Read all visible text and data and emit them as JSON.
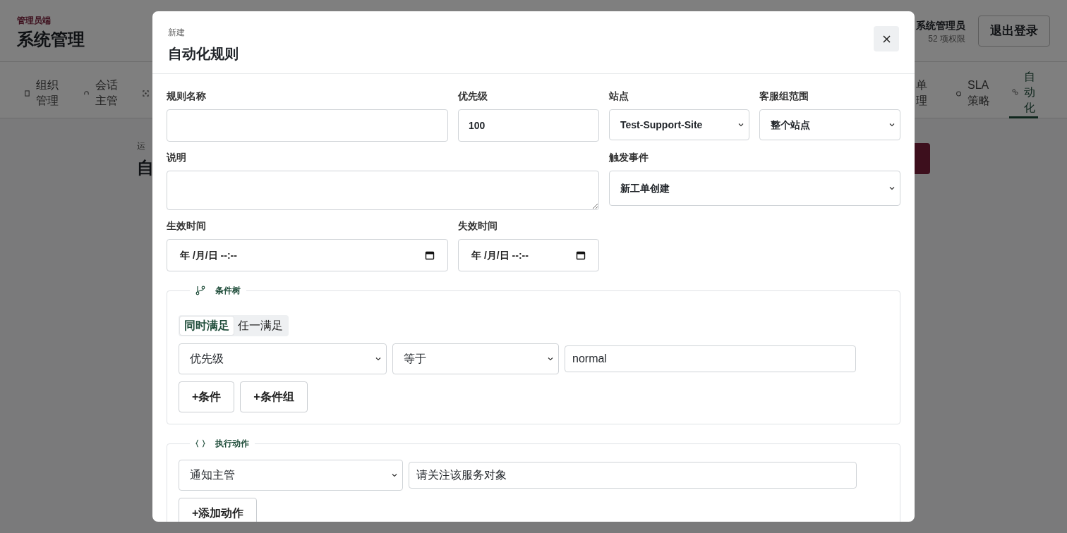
{
  "header": {
    "role_label": "管理员端",
    "title": "系统管理",
    "user_name": "系统管理员",
    "permission_count": "52 项权限",
    "logout": "退出登录"
  },
  "nav_tabs": [
    {
      "kind": "text",
      "label": "组织管理",
      "selected": false
    },
    {
      "kind": "text",
      "label": "会话主管",
      "selected": false
    },
    {
      "kind": "icon_only",
      "selected": false
    },
    {
      "kind": "cut",
      "label": "单理",
      "selected": false
    },
    {
      "kind": "text",
      "label": "SLA策略",
      "selected": false
    },
    {
      "kind": "text",
      "label": "自动化",
      "selected": true
    }
  ],
  "page_heading": {
    "eyebrow": "运",
    "title": "自"
  },
  "modal": {
    "eyebrow": "新建",
    "title": "自动化规则",
    "fields": [
      {
        "kind": "text",
        "label": "规则名称"
      },
      {
        "kind": "text",
        "label": "优先级",
        "value": "100"
      },
      {
        "kind": "select",
        "label": "站点",
        "value": "Test-Support-Site"
      },
      {
        "kind": "select",
        "label": "客服组范围",
        "value": "整个站点"
      },
      {
        "kind": "textarea",
        "label": "说明"
      },
      {
        "kind": "select",
        "label": "触发事件",
        "value": "新工单创建"
      },
      {
        "kind": "datetime",
        "label": "生效时间",
        "placeholder": "年 /月/日 --:--"
      },
      {
        "kind": "datetime",
        "label": "失效时间",
        "placeholder": "年 /月/日 --:--"
      }
    ],
    "conditions": {
      "title": "条件树",
      "match_modes": [
        {
          "label": "同时满足",
          "selected": true
        },
        {
          "label": "任一满足",
          "selected": false
        }
      ],
      "rows": [
        {
          "field": "优先级",
          "operator": "等于",
          "value": "normal"
        }
      ],
      "buttons": [
        "+条件",
        "+条件组"
      ]
    },
    "actions": {
      "title": "执行动作",
      "rows": [
        {
          "action": "通知主管",
          "value": "请关注该服务对象"
        }
      ],
      "buttons": [
        "+添加动作"
      ]
    }
  }
}
